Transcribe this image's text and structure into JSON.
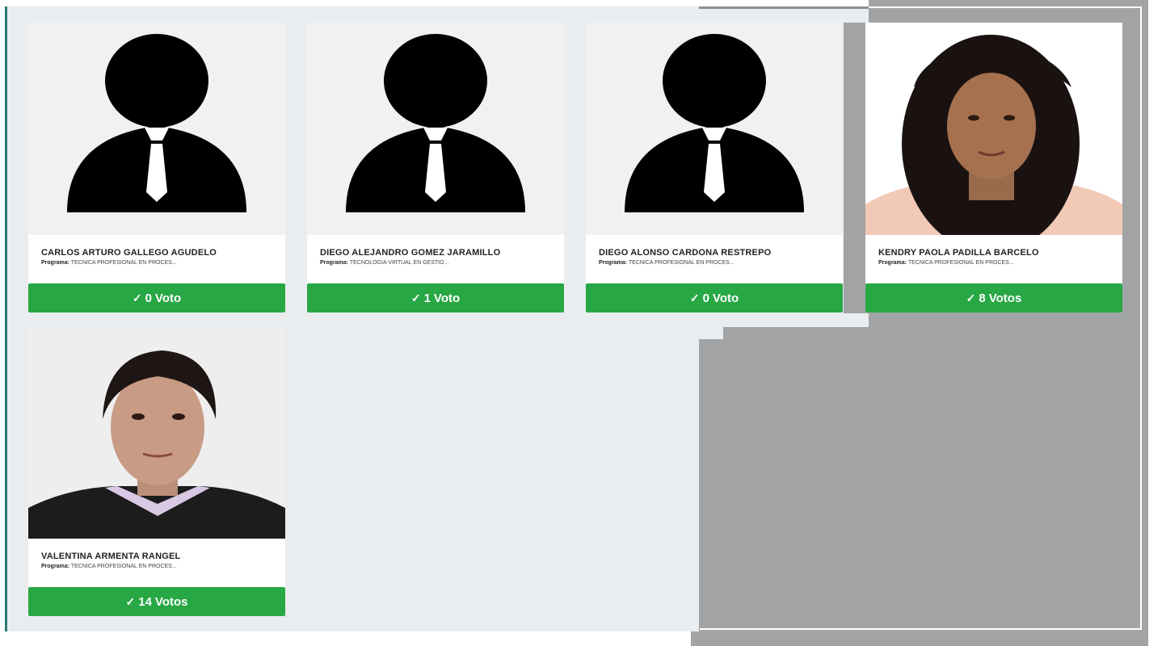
{
  "program_label": "Programa:",
  "candidates": [
    {
      "name": "CARLOS ARTURO GALLEGO AGUDELO",
      "program": "TÉCNICA PROFESIONAL EN PROCES...",
      "vote_count": "0",
      "vote_word": "Voto",
      "photo": "default-avatar-icon"
    },
    {
      "name": "DIEGO ALEJANDRO GOMEZ JARAMILLO",
      "program": "TECNOLOGÍA VIRTUAL EN GESTIÓ...",
      "vote_count": "1",
      "vote_word": "Voto",
      "photo": "default-avatar-icon"
    },
    {
      "name": "DIEGO ALONSO CARDONA RESTREPO",
      "program": "TÉCNICA PROFESIONAL EN PROCES...",
      "vote_count": "0",
      "vote_word": "Voto",
      "photo": "default-avatar-icon"
    },
    {
      "name": "KENDRY PAOLA PADILLA BARCELO",
      "program": "TÉCNICA PROFESIONAL EN PROCES...",
      "vote_count": "8",
      "vote_word": "Votos",
      "photo": "candidate-photo"
    },
    {
      "name": "VALENTINA ARMENTA RANGEL",
      "program": "TÉCNICA PROFESIONAL EN PROCES...",
      "vote_count": "14",
      "vote_word": "Votos",
      "photo": "candidate-photo"
    }
  ],
  "colors": {
    "vote_button": "#28a745",
    "panel_background": "#e9edf0",
    "overlay_gray": "#a2a3a5",
    "accent_border": "#2b7a78"
  }
}
